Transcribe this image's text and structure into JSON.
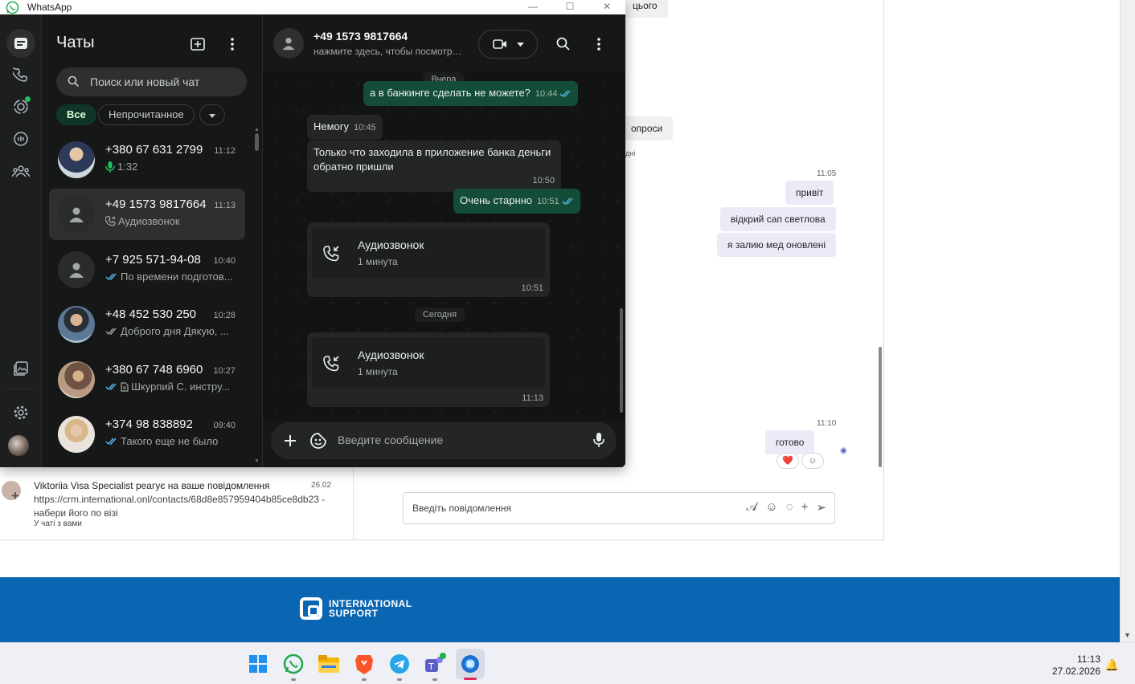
{
  "background": {
    "fragments": {
      "top_right_text": "цього",
      "questions": "опроси",
      "small_text": "дні"
    },
    "messages": [
      {
        "time": "11:05"
      },
      {
        "text": "привіт"
      },
      {
        "text": "відкрий сап светлова"
      },
      {
        "text": "я залию мед оновлені"
      },
      {
        "time": "11:10"
      },
      {
        "text": "готово"
      }
    ],
    "reactions": [
      "❤️",
      "☺"
    ],
    "composer_placeholder": "Введіть повідомлення",
    "notification": {
      "title": "Viktoriia Visa Specialist реагує на ваше повідомлення",
      "date": "26.02",
      "body": "https://crm.international.onl/contacts/68d8e857959404b85ce8db23 - набери його по візі",
      "sub": "У чаті з вами"
    },
    "banner": {
      "line1": "INTERNATIONAL",
      "line2": "SUPPORT",
      "color": "#0a66b2"
    }
  },
  "taskbar": {
    "time": "11:13",
    "date": "27.02.2026",
    "apps": [
      "windows-start-icon",
      "whatsapp-icon",
      "file-explorer-icon",
      "brave-icon",
      "telegram-icon",
      "teams-icon",
      "browser-app-icon"
    ]
  },
  "whatsapp": {
    "window_title": "WhatsApp",
    "accent": "#21c063",
    "list": {
      "title": "Чаты",
      "search_placeholder": "Поиск или новый чат",
      "filters": [
        "Все",
        "Непрочитанное"
      ],
      "chats": [
        {
          "name": "+380 67 631 2799",
          "time": "11:12",
          "preview": "1:32",
          "preview_icon": "mic-icon"
        },
        {
          "name": "+49 1573 9817664",
          "time": "11:13",
          "preview": "Аудиозвонок",
          "preview_icon": "call-icon"
        },
        {
          "name": "+7 925 571-94-08",
          "time": "10:40",
          "preview": "По времени подготов...",
          "preview_icon": "read-ticks-icon"
        },
        {
          "name": "+48 452 530 250",
          "time": "10:28",
          "preview": "Доброго дня Дякую, ...",
          "preview_icon": "sent-ticks-icon"
        },
        {
          "name": "+380 67 748 6960",
          "time": "10:27",
          "preview": "Шкурпий С. инстру...",
          "preview_icon": "read-ticks-icon"
        },
        {
          "name": "+374 98 838892",
          "time": "09:40",
          "preview": "Такого еще не было",
          "preview_icon": "read-ticks-icon"
        }
      ]
    },
    "chat": {
      "name": "+49 1573 9817664",
      "subtitle": "нажмите здесь, чтобы посмотреть данные контакта",
      "date_yesterday": "Вчера",
      "date_today": "Сегодня",
      "messages": [
        {
          "text": "а в банкинге сделать не можете?",
          "time": "10:44",
          "dir": "out"
        },
        {
          "text": "Немогу",
          "time": "10:45",
          "dir": "in"
        },
        {
          "text": "Только что заходила в приложение банка деньги обратно пришли",
          "time": "10:50",
          "dir": "in"
        },
        {
          "text": "Очень старнно",
          "time": "10:51",
          "dir": "out"
        }
      ],
      "calls": [
        {
          "title": "Аудиозвонок",
          "duration": "1 минута",
          "time": "10:51"
        },
        {
          "title": "Аудиозвонок",
          "duration": "1 минута",
          "time": "11:13"
        }
      ],
      "composer_placeholder": "Введите сообщение"
    }
  }
}
